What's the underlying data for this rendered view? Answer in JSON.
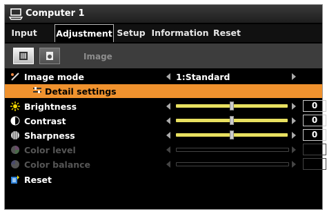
{
  "title": "Computer 1",
  "tabs": [
    {
      "label": "Input",
      "active": false
    },
    {
      "label": "Adjustment",
      "active": true
    },
    {
      "label": "Setup",
      "active": false
    },
    {
      "label": "Information",
      "active": false
    },
    {
      "label": "Reset",
      "active": false
    }
  ],
  "subbar": {
    "label": "Image",
    "buttons": [
      "image-adjust-icon",
      "options-icon"
    ]
  },
  "rows": {
    "image_mode": {
      "label": "Image mode",
      "value": "1:Standard"
    },
    "detail": {
      "label": "Detail settings"
    },
    "brightness": {
      "label": "Brightness",
      "value": "0",
      "level": 0.5
    },
    "contrast": {
      "label": "Contrast",
      "value": "0",
      "level": 0.5
    },
    "sharpness": {
      "label": "Sharpness",
      "value": "0",
      "level": 0.5
    },
    "color_level": {
      "label": "Color level",
      "value": "",
      "enabled": false
    },
    "color_balance": {
      "label": "Color balance",
      "value": "",
      "enabled": false
    },
    "reset": {
      "label": "Reset"
    }
  },
  "colors": {
    "highlight": "#f0922e",
    "slider": "#e8e060"
  }
}
